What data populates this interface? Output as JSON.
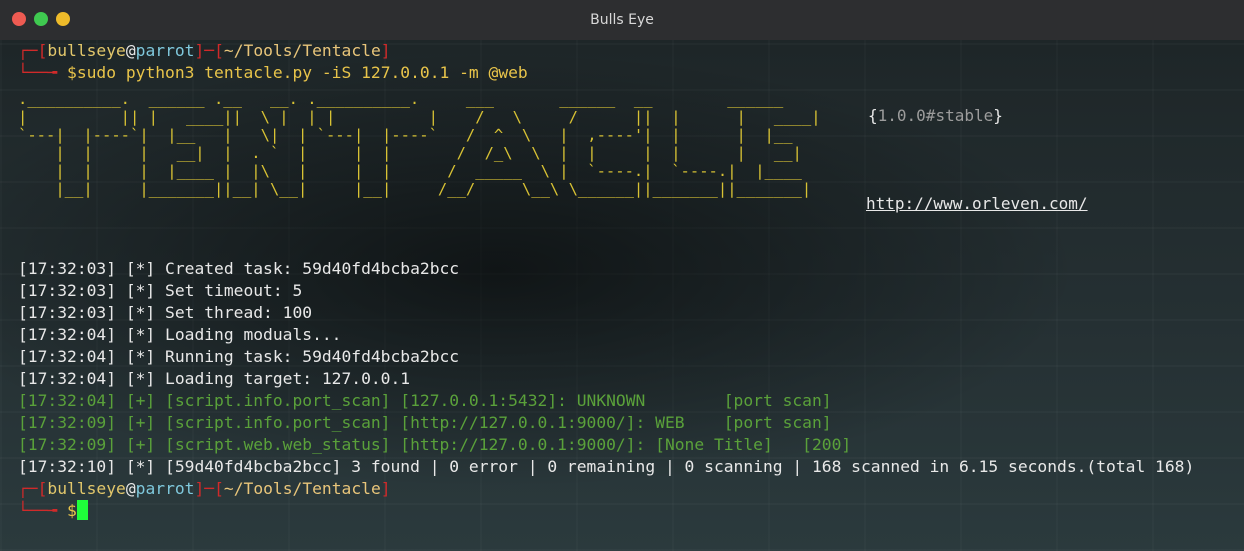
{
  "window": {
    "title": "Bulls Eye"
  },
  "prompt1": {
    "user": "bullseye",
    "at": "@",
    "host": "parrot",
    "path": "~/Tools/Tentacle",
    "command": "sudo python3 tentacle.py -iS 127.0.0.1 -m @web"
  },
  "banner": {
    "art": ".__________.  ______ .__   __. .__________.     ___       ______  __        ______\n|          || |   ____||  \\ |  | |          |    /   \\     /      ||  |      |   ____| \n`---|  |----`|  |__   |   \\|  | `---|  |----`   /  ^  \\   |  ,----'|  |      |  |__\n    |  |     |   __|  |  . `  |     |  |       /  /_\\  \\  |  |     |  |      |   __|\n    |  |     |  |____ |  |\\   |     |  |      /  _____  \\ |  `----.|  `----.|  |____\n    |__|     |_______||__| \\__|     |__|     /__/     \\__\\ \\______||_______||_______|",
    "version": "1.0.0#stable",
    "url": "http://www.orleven.com/"
  },
  "log": [
    "[17:32:03] [*] Created task: 59d40fd4bcba2bcc",
    "[17:32:03] [*] Set timeout: 5",
    "[17:32:03] [*] Set thread: 100",
    "[17:32:04] [*] Loading moduals...",
    "[17:32:04] [*] Running task: 59d40fd4bcba2bcc",
    "[17:32:04] [*] Loading target: 127.0.0.1",
    "[17:32:04] [+] [script.info.port_scan] [127.0.0.1:5432]: UNKNOWN        [port scan]",
    "[17:32:09] [+] [script.info.port_scan] [http://127.0.0.1:9000/]: WEB    [port scan]",
    "[17:32:09] [+] [script.web.web_status] [http://127.0.0.1:9000/]: [None Title]   [200]",
    "[17:32:10] [*] [59d40fd4bcba2bcc] 3 found | 0 error | 0 remaining | 0 scanning | 168 scanned in 6.15 seconds.(total 168)"
  ],
  "prompt2": {
    "user": "bullseye",
    "at": "@",
    "host": "parrot",
    "path": "~/Tools/Tentacle",
    "symbol": "$"
  }
}
